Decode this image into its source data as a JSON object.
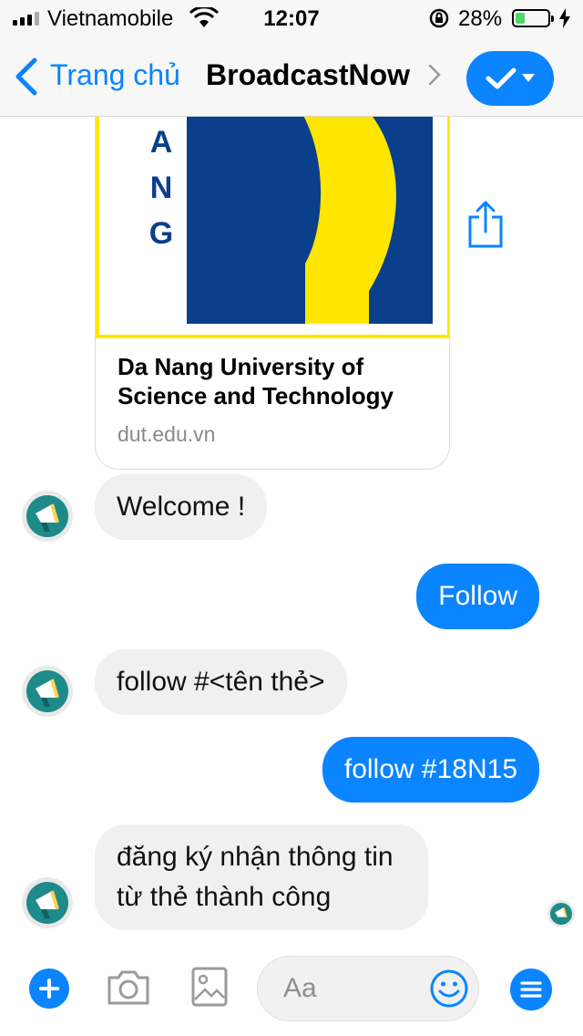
{
  "status_bar": {
    "carrier": "Vietnamobile",
    "time": "12:07",
    "battery_percent": "28%",
    "battery_level": 0.28
  },
  "nav": {
    "back_label": "Trang chủ",
    "title": "BroadcastNow"
  },
  "card": {
    "title": "Da Nang University of Science and Technology",
    "url": "dut.edu.vn",
    "logo_letters": [
      "A",
      "N",
      "G"
    ]
  },
  "messages": [
    {
      "from": "bot",
      "text": "Welcome !"
    },
    {
      "from": "user",
      "text": "Follow"
    },
    {
      "from": "bot",
      "text": "follow #<tên thẻ>"
    },
    {
      "from": "user",
      "text": "follow #18N15"
    },
    {
      "from": "bot",
      "text": "đăng ký nhận thông tin từ thẻ thành công"
    }
  ],
  "composer": {
    "placeholder": "Aa"
  },
  "colors": {
    "accent": "#0a84ff",
    "bubble_in": "#f0f0f0",
    "logo_blue": "#0a3f8c",
    "logo_yellow": "#ffe600",
    "bot_avatar_teal": "#1e8a8a"
  }
}
